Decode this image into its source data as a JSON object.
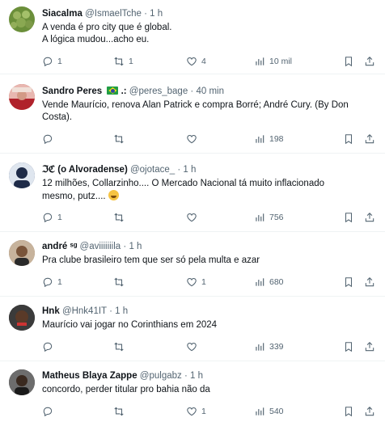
{
  "tweets": [
    {
      "name": "Siacalma",
      "handle": "@IsmaelTche",
      "time": "1 h",
      "text1": "A venda é pro city que é global.",
      "text2": "A lógica mudou...acho eu.",
      "replies": "1",
      "retweets": "1",
      "likes": "4",
      "views": "10 mil",
      "avatar_color": "#6b8f3a"
    },
    {
      "name": "Sandro Peres",
      "name_suffix": ".:",
      "handle": "@peres_bage",
      "time": "40 min",
      "text1": "Vende Maurício, renova Alan Patrick e compra Borré; André Cury. (By Don",
      "text2": "Costa).",
      "replies": "",
      "retweets": "",
      "likes": "",
      "views": "198",
      "avatar_color": "#c0392b"
    },
    {
      "name": "ℑℭ (o Alvoradense)",
      "handle": "@ojotace_",
      "time": "1 h",
      "text1": "12 milhões, Collarzinho.... O Mercado Nacional tá muito inflacionado",
      "text2": "mesmo, putz....",
      "replies": "1",
      "retweets": "",
      "likes": "",
      "views": "756",
      "avatar_color": "#2c3e66"
    },
    {
      "name": "andré ˢᵍ",
      "handle": "@aviiiiiiila",
      "time": "1 h",
      "text1": "Pra clube brasileiro tem que ser só pela multa e azar",
      "text2": "",
      "replies": "1",
      "retweets": "",
      "likes": "1",
      "views": "680",
      "avatar_color": "#8a6a4a"
    },
    {
      "name": "Hnk",
      "handle": "@Hnk41IT",
      "time": "1 h",
      "text1": "Maurício vai jogar no Corinthians em 2024",
      "text2": "",
      "replies": "",
      "retweets": "",
      "likes": "",
      "views": "339",
      "avatar_color": "#2b2b2b"
    },
    {
      "name": "Matheus Blaya Zappe",
      "handle": "@pulgabz",
      "time": "1 h",
      "text1": "concordo, perder titular pro bahia não da",
      "text2": "",
      "replies": "",
      "retweets": "",
      "likes": "1",
      "views": "540",
      "avatar_color": "#3a3a3a"
    }
  ],
  "dot": "·",
  "colors": {
    "text": "#0f1419",
    "muted": "#536471",
    "divider": "#eff3f4"
  }
}
